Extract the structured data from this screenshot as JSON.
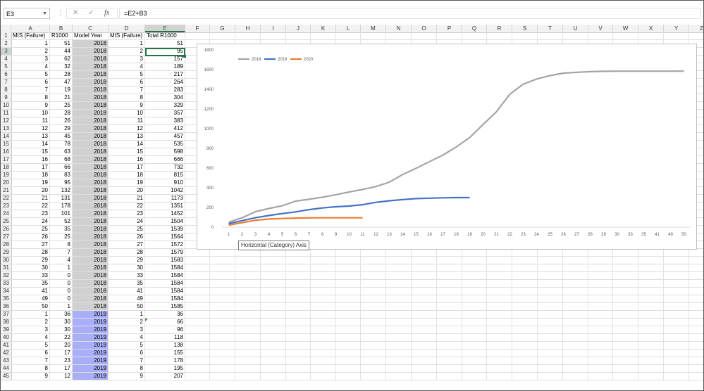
{
  "name_box": "E3",
  "formula": "=E2+B3",
  "colors": {
    "accent": "#217346",
    "series_2018": "#a5a5a5",
    "series_2019": "#4472c4",
    "series_2020": "#ed7d31",
    "highlight_2019": "#a9aef8",
    "highlight_gray": "#d0d0d0"
  },
  "columns": [
    "A",
    "B",
    "C",
    "D",
    "E",
    "F",
    "G",
    "H",
    "I",
    "J",
    "K",
    "L",
    "M",
    "N",
    "O",
    "P",
    "Q",
    "R",
    "S",
    "T",
    "U",
    "V",
    "W",
    "X",
    "Y",
    "Z"
  ],
  "header_row": [
    "MIS (Failure)",
    "R1000",
    "Model Year",
    "MIS (Failure)",
    "Total R1000"
  ],
  "rows": [
    [
      1,
      51,
      2018,
      1,
      51
    ],
    [
      2,
      44,
      2018,
      2,
      95
    ],
    [
      3,
      62,
      2018,
      3,
      157
    ],
    [
      4,
      32,
      2018,
      4,
      189
    ],
    [
      5,
      28,
      2018,
      5,
      217
    ],
    [
      6,
      47,
      2018,
      6,
      264
    ],
    [
      7,
      19,
      2018,
      7,
      283
    ],
    [
      8,
      21,
      2018,
      8,
      304
    ],
    [
      9,
      25,
      2018,
      9,
      329
    ],
    [
      10,
      28,
      2018,
      10,
      357
    ],
    [
      11,
      26,
      2018,
      11,
      383
    ],
    [
      12,
      29,
      2018,
      12,
      412
    ],
    [
      13,
      45,
      2018,
      13,
      457
    ],
    [
      14,
      78,
      2018,
      14,
      535
    ],
    [
      15,
      63,
      2018,
      15,
      598
    ],
    [
      16,
      68,
      2018,
      16,
      666
    ],
    [
      17,
      66,
      2018,
      17,
      732
    ],
    [
      18,
      83,
      2018,
      18,
      815
    ],
    [
      19,
      95,
      2018,
      19,
      910
    ],
    [
      20,
      132,
      2018,
      20,
      1042
    ],
    [
      21,
      131,
      2018,
      21,
      1173
    ],
    [
      22,
      178,
      2018,
      22,
      1351
    ],
    [
      23,
      101,
      2018,
      23,
      1452
    ],
    [
      24,
      52,
      2018,
      24,
      1504
    ],
    [
      25,
      35,
      2018,
      25,
      1539
    ],
    [
      26,
      25,
      2018,
      26,
      1564
    ],
    [
      27,
      8,
      2018,
      27,
      1572
    ],
    [
      28,
      7,
      2018,
      28,
      1579
    ],
    [
      29,
      4,
      2018,
      29,
      1583
    ],
    [
      30,
      1,
      2018,
      30,
      1584
    ],
    [
      33,
      0,
      2018,
      33,
      1584
    ],
    [
      35,
      0,
      2018,
      35,
      1584
    ],
    [
      41,
      0,
      2018,
      41,
      1584
    ],
    [
      49,
      0,
      2018,
      49,
      1584
    ],
    [
      50,
      1,
      2018,
      50,
      1585
    ],
    [
      1,
      36,
      2019,
      1,
      36
    ],
    [
      2,
      30,
      2019,
      2,
      66
    ],
    [
      3,
      30,
      2019,
      3,
      96
    ],
    [
      4,
      22,
      2019,
      4,
      118
    ],
    [
      5,
      20,
      2019,
      5,
      138
    ],
    [
      6,
      17,
      2019,
      6,
      155
    ],
    [
      7,
      23,
      2019,
      7,
      178
    ],
    [
      8,
      17,
      2019,
      8,
      195
    ],
    [
      9,
      12,
      2019,
      9,
      207
    ]
  ],
  "tooltip": "Horizontal (Category) Axis",
  "chart_data": {
    "type": "line",
    "categories": [
      "1",
      "2",
      "3",
      "4",
      "5",
      "6",
      "7",
      "8",
      "9",
      "10",
      "11",
      "12",
      "13",
      "14",
      "15",
      "16",
      "17",
      "18",
      "19",
      "20",
      "21",
      "22",
      "23",
      "24",
      "25",
      "26",
      "27",
      "28",
      "29",
      "30",
      "33",
      "35",
      "41",
      "49",
      "50"
    ],
    "yticks": [
      0,
      200,
      400,
      600,
      800,
      1000,
      1200,
      1400,
      1600,
      1800
    ],
    "ylim": [
      0,
      1800
    ],
    "legend_position": "top-left",
    "series": [
      {
        "name": "2018",
        "color": "#a5a5a5",
        "values": [
          51,
          95,
          157,
          189,
          217,
          264,
          283,
          304,
          329,
          357,
          383,
          412,
          457,
          535,
          598,
          666,
          732,
          815,
          910,
          1042,
          1173,
          1351,
          1452,
          1504,
          1539,
          1564,
          1572,
          1579,
          1583,
          1584,
          1584,
          1584,
          1584,
          1584,
          1585
        ]
      },
      {
        "name": "2019",
        "color": "#4472c4",
        "values": [
          36,
          66,
          96,
          118,
          138,
          155,
          178,
          195,
          207,
          214,
          228,
          252,
          268,
          280,
          290,
          294,
          298,
          300,
          300
        ]
      },
      {
        "name": "2020",
        "color": "#ed7d31",
        "values": [
          20,
          45,
          70,
          82,
          88,
          92,
          94,
          95,
          95,
          95,
          95
        ]
      }
    ]
  }
}
